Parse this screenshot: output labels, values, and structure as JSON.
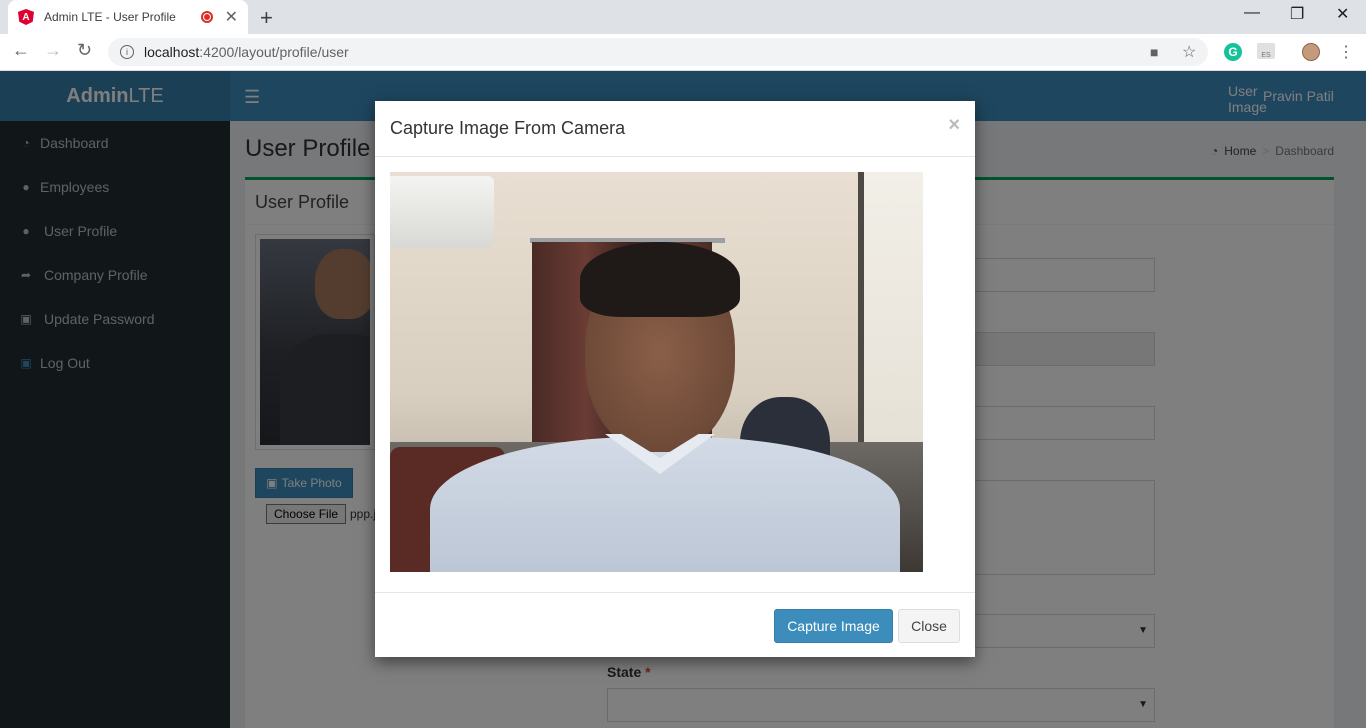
{
  "browser": {
    "tab_title": "Admin LTE - User Profile",
    "new_tab": "+",
    "url_host": "localhost",
    "url_path": ":4200/layout/profile/user",
    "minimize": "—",
    "restore": "❐",
    "close": "✕"
  },
  "app": {
    "logo_bold": "Admin",
    "logo_light": "LTE",
    "user_image_alt": "User Image",
    "user_name": "Pravin Patil"
  },
  "sidebar": {
    "items": [
      {
        "label": "Dashboard",
        "icon": "dashboard-icon"
      },
      {
        "label": "Employees",
        "icon": "user-icon"
      },
      {
        "label": "User Profile",
        "icon": "user-icon"
      },
      {
        "label": "Company Profile",
        "icon": "share-icon"
      },
      {
        "label": "Update Password",
        "icon": "lock-icon"
      },
      {
        "label": "Log Out",
        "icon": "lock-icon"
      }
    ]
  },
  "content": {
    "title": "User Profile",
    "breadcrumb_home": "Home",
    "breadcrumb_sep": ">",
    "breadcrumb_current": "Dashboard",
    "box_title": "User Profile",
    "take_photo": "Take Photo",
    "choose_file": "Choose File",
    "file_name": "ppp.j",
    "state_label": "State",
    "required_mark": "*"
  },
  "modal": {
    "title": "Capture Image From Camera",
    "close_x": "×",
    "capture_button": "Capture Image",
    "close_button": "Close"
  },
  "colors": {
    "primary": "#3c8dbc",
    "sidebar": "#222d32",
    "success": "#00a65a"
  }
}
